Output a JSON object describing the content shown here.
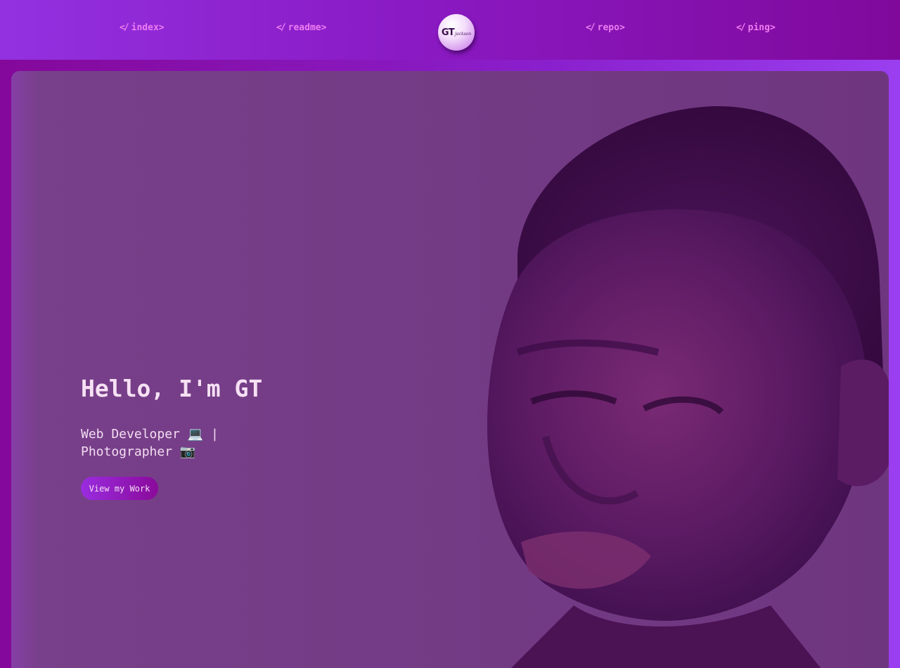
{
  "nav": {
    "links": [
      {
        "label": "index>",
        "icon": "code-icon"
      },
      {
        "label": "readme>",
        "icon": "code-icon"
      },
      {
        "label": "repo>",
        "icon": "code-icon"
      },
      {
        "label": "ping>",
        "icon": "code-icon"
      }
    ],
    "code_glyph": "</",
    "logo": {
      "main": "GT",
      "sub": "jackson"
    }
  },
  "hero": {
    "title": "Hello, I'm GT",
    "subtitle_line1": "Web Developer 💻 |",
    "subtitle_line2": "Photographer 📷",
    "button_label": "View my Work",
    "image": "portrait-photo"
  },
  "colors": {
    "nav_link": "#ee7ef0",
    "hero_overlay": "#743a82",
    "accent_start": "#9a2ce0",
    "accent_end": "#8a0a9a"
  }
}
